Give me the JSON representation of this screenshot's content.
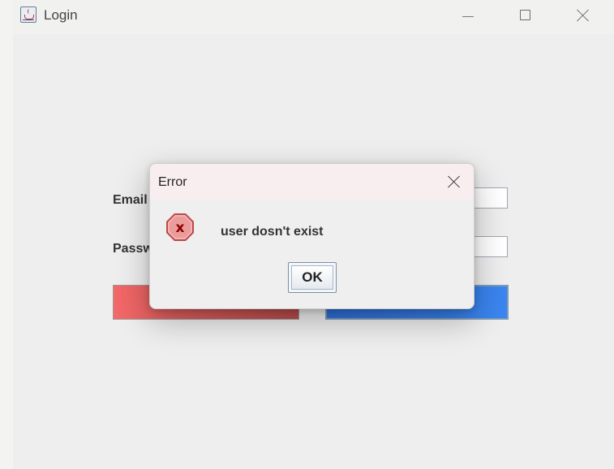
{
  "window": {
    "title": "Login",
    "controls": [
      "minimize-icon",
      "maximize-icon",
      "close-icon"
    ]
  },
  "form": {
    "email_label": "Email",
    "password_label": "Password",
    "email_value": "",
    "password_value": "",
    "left_button_color": "#e35a5a",
    "right_button_color": "#3a7de6"
  },
  "dialog": {
    "title": "Error",
    "icon": "error-x-icon",
    "message": "user dosn't exist",
    "ok_label": "OK",
    "close_icon": "close-icon"
  }
}
